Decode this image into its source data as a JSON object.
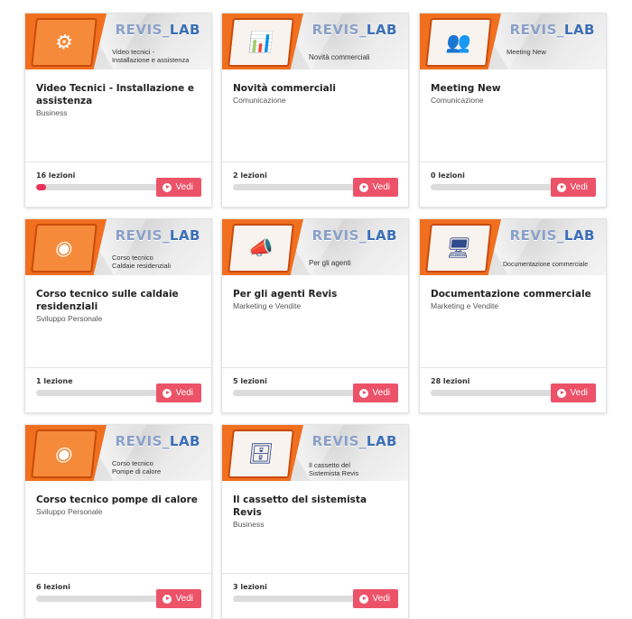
{
  "brand": {
    "logo_main": "REVIS",
    "logo_sep": "_",
    "logo_lab": "LAB",
    "accent": "#f07020",
    "button_color": "#ec5268",
    "progress_color": "#e8325a"
  },
  "button_label": "Vedi",
  "courses": [
    {
      "title": "Video Tecnici - Installazione e assistenza",
      "category": "Business",
      "lessons": "16 lezioni",
      "progress": 0.06,
      "banner_caption": "Video tecnici -\nInstallazione e assistenza",
      "icon": "wrench-gear-icon"
    },
    {
      "title": "Novità commerciali",
      "category": "Comunicazione",
      "lessons": "2 lezioni",
      "progress": 0,
      "banner_caption": "Novità commerciali",
      "icon": "presentation-icon"
    },
    {
      "title": "Meeting New",
      "category": "Comunicazione",
      "lessons": "0 lezioni",
      "progress": 0,
      "banner_caption": "Meeting New",
      "icon": "meeting-icon"
    },
    {
      "title": "Corso tecnico sulle caldaie residenziali",
      "category": "Sviluppo Personale",
      "lessons": "1 lezione",
      "progress": 0,
      "banner_caption": "Corso tecnico\nCaldaie residenziali",
      "icon": "boiler-network-icon"
    },
    {
      "title": "Per gli agenti Revis",
      "category": "Marketing e Vendite",
      "lessons": "5 lezioni",
      "progress": 0,
      "banner_caption": "Per gli agenti",
      "icon": "agent-megaphone-icon"
    },
    {
      "title": "Documentazione commerciale",
      "category": "Marketing e Vendite",
      "lessons": "28 lezioni",
      "progress": 0,
      "banner_caption": "Documentazione commerciale",
      "icon": "office-desk-icon"
    },
    {
      "title": "Corso tecnico pompe di calore",
      "category": "Sviluppo Personale",
      "lessons": "6 lezioni",
      "progress": 0,
      "banner_caption": "Corso tecnico\nPompe di calore",
      "icon": "heat-pump-network-icon"
    },
    {
      "title": "Il cassetto del sistemista Revis",
      "category": "Business",
      "lessons": "3 lezioni",
      "progress": 0,
      "banner_caption": "Il cassetto del\nSistemista Revis",
      "icon": "drawer-cabinet-icon"
    }
  ]
}
